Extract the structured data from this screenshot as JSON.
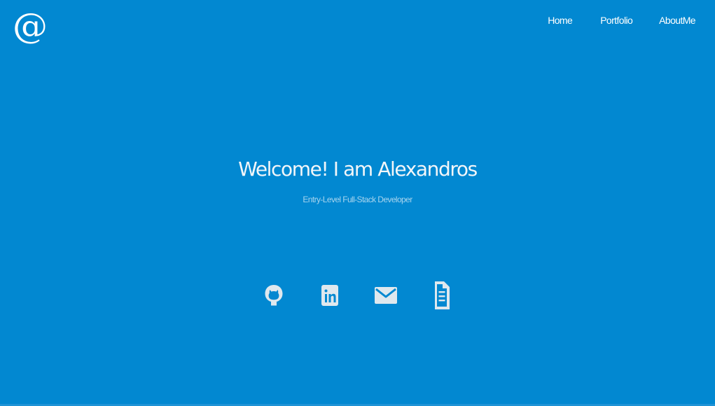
{
  "logo": {
    "icon": "at-sign-icon",
    "glyph": "@"
  },
  "nav": {
    "items": [
      {
        "label": "Home"
      },
      {
        "label": "Portfolio"
      },
      {
        "label": "AboutMe"
      }
    ]
  },
  "hero": {
    "title": "Welcome! I am Alexandros",
    "subtitle": "Entry-Level Full-Stack Developer"
  },
  "social": {
    "items": [
      {
        "icon": "github-icon"
      },
      {
        "icon": "linkedin-icon"
      },
      {
        "icon": "email-icon"
      },
      {
        "icon": "resume-document-icon"
      }
    ]
  },
  "colors": {
    "background": "#0288d1",
    "text": "#ffffff",
    "subtitle": "#a7d4ee",
    "icon": "#dfe8ee"
  }
}
